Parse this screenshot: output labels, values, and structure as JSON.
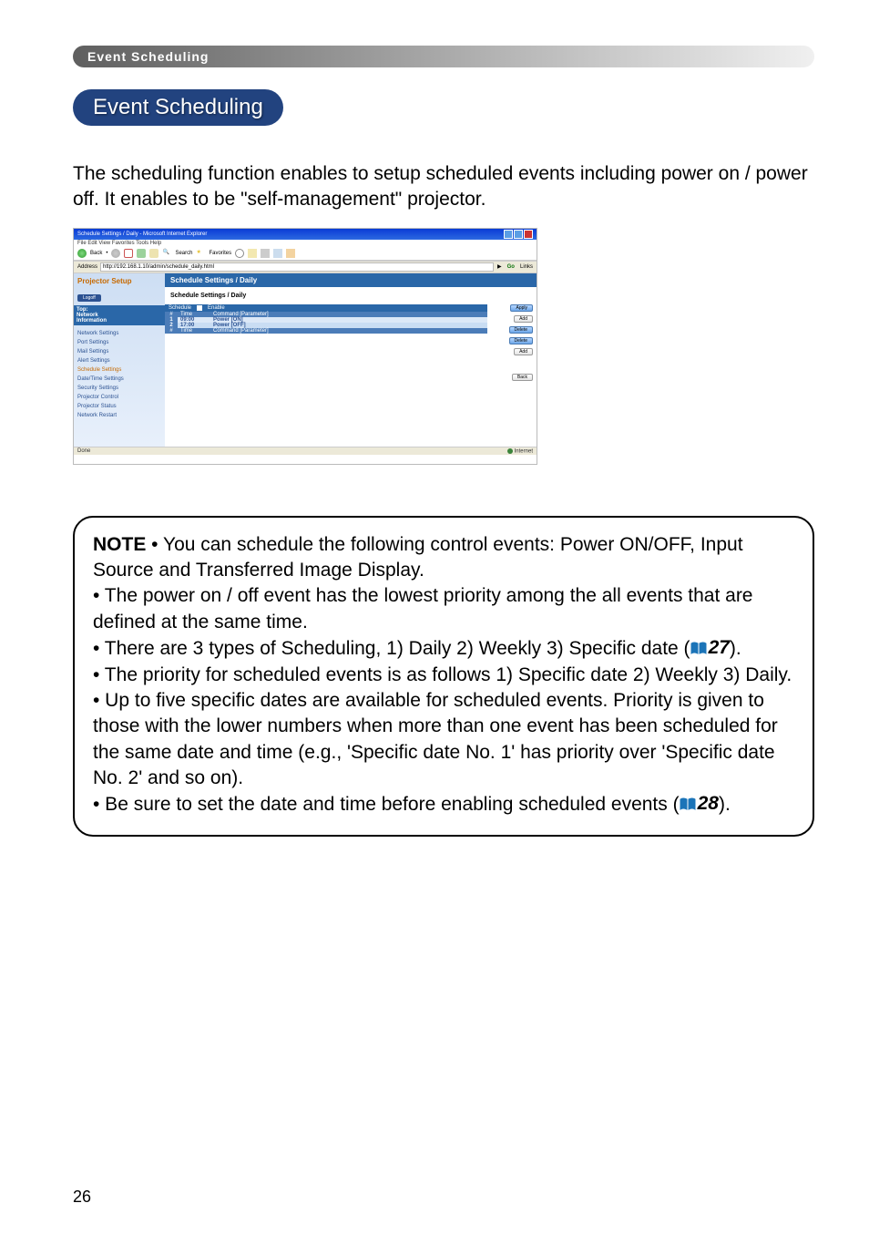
{
  "breadcrumb": "Event Scheduling",
  "title": "Event Scheduling",
  "intro": "The scheduling function enables to setup scheduled events including power on / power off. It enables to be \"self-management\" projector.",
  "page_number": "26",
  "note": {
    "label": "NOTE",
    "line1_a": " • You can schedule the following control events: Power ON/OFF, Input Source and Transferred Image Display.",
    "line2": "• The power on / off event has the lowest priority among the all events that are defined at the same time.",
    "line3_a": "• There are 3 types of Scheduling, 1) Daily 2) Weekly 3) Specific date (",
    "line3_ref": "27",
    "line3_b": ").",
    "line4": "• The priority for scheduled events is as follows 1) Specific date 2) Weekly 3) Daily.",
    "line5": "• Up to five specific dates are available for scheduled events. Priority is given to those with the lower numbers when more than one event has been scheduled for the same date and time (e.g., 'Specific date No. 1' has priority over 'Specific date No. 2' and so on).",
    "line6_a": "• Be sure to set the date and time before enabling scheduled events (",
    "line6_ref": "28",
    "line6_b": ")."
  },
  "browser": {
    "title": "Schedule Settings / Daily - Microsoft Internet Explorer",
    "url": "http://192.168.1.10/admin/schedule_daily.html",
    "menus": "File   Edit   View   Favorites   Tools   Help",
    "tool_back": "Back",
    "tool_search": "Search",
    "tool_fav": "Favorites",
    "go": "Go",
    "links": "Links",
    "status_done": "Done",
    "status_zone": "Internet"
  },
  "app": {
    "product": "Projector Setup",
    "logoff": "Logoff",
    "top_block_l1": "Top:",
    "top_block_l2": "Network",
    "top_block_l3": "Information",
    "nav": {
      "n1": "Network Settings",
      "n2": "Port Settings",
      "n3": "Mail Settings",
      "n4": "Alert Settings",
      "n5": "Schedule Settings",
      "n6": "Date/Time Settings",
      "n7": "Security Settings",
      "n8": "Projector Control",
      "n9": "Projector Status",
      "n10": "Network Restart"
    },
    "header": "Schedule Settings / Daily",
    "subtitle": "Schedule Settings / Daily",
    "schedule_label": "Schedule",
    "enable_label": "Enable",
    "apply": "Apply",
    "add": "Add",
    "delete": "Delete",
    "back": "Back",
    "table": {
      "h_num": "#",
      "h_time": "Time",
      "h_cmd": "Command [Parameter]",
      "r1_num": "1",
      "r1_time": "09:00",
      "r1_cmd": "Power [ON]",
      "r2_num": "2",
      "r2_time": "17:00",
      "r2_cmd": "Power [OFF]",
      "rn_num": "#",
      "rn_time": "Time",
      "rn_cmd": "Command [Parameter]"
    }
  }
}
